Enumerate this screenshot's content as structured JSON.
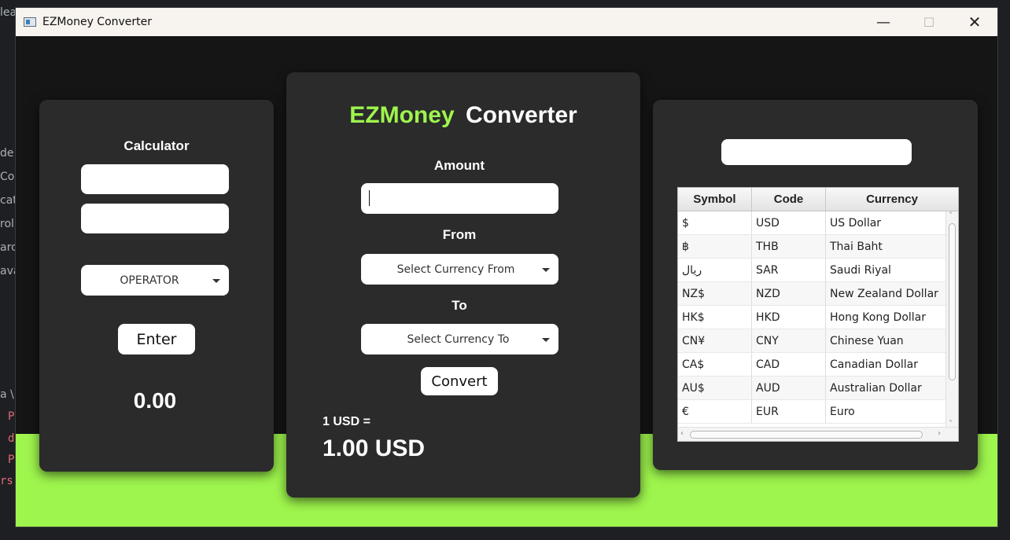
{
  "background": {
    "left_fragments": [
      "de",
      "Cor",
      "cat",
      "roll",
      "arc",
      "ava"
    ],
    "code_fragments": [
      "P",
      "d",
      "P",
      "rs"
    ],
    "top_fragment": "lea",
    "path_fragment": "a \\"
  },
  "window": {
    "title": "EZMoney Converter",
    "minimize_glyph": "—",
    "maximize_glyph": "☐",
    "close_glyph": "✕"
  },
  "calculator": {
    "title": "Calculator",
    "input1_value": "",
    "input2_value": "",
    "operator_label": "OPERATOR",
    "enter_label": "Enter",
    "result": "0.00"
  },
  "converter": {
    "title_part1": "EZMoney",
    "title_part2": "Converter",
    "amount_label": "Amount",
    "amount_value": "",
    "from_label": "From",
    "from_select": "Select Currency From",
    "to_label": "To",
    "to_select": "Select Currency To",
    "convert_label": "Convert",
    "rate_label": "1 USD =",
    "rate_value": "1.00 USD"
  },
  "currency_table": {
    "search_value": "",
    "headers": [
      "Symbol",
      "Code",
      "Currency"
    ],
    "rows": [
      [
        "$",
        "USD",
        "US Dollar"
      ],
      [
        "฿",
        "THB",
        "Thai Baht"
      ],
      [
        "ريال",
        "SAR",
        "Saudi Riyal"
      ],
      [
        "NZ$",
        "NZD",
        "New Zealand Dollar"
      ],
      [
        "HK$",
        "HKD",
        "Hong Kong Dollar"
      ],
      [
        "CN¥",
        "CNY",
        "Chinese Yuan"
      ],
      [
        "CA$",
        "CAD",
        "Canadian Dollar"
      ],
      [
        "AU$",
        "AUD",
        "Australian Dollar"
      ],
      [
        "€",
        "EUR",
        "Euro"
      ]
    ]
  },
  "colors": {
    "accent_green": "#9ef54d",
    "card_bg": "#2b2b2b",
    "window_bg": "#151516"
  }
}
